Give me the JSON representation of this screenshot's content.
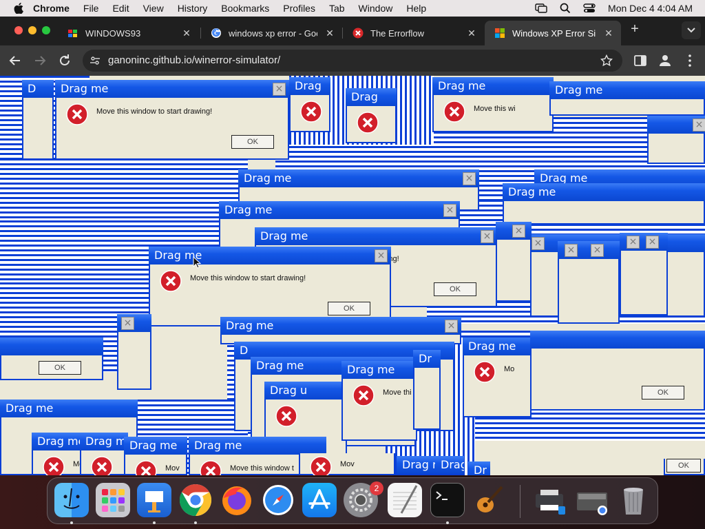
{
  "menubar": {
    "app_name": "Chrome",
    "items": [
      "File",
      "Edit",
      "View",
      "History",
      "Bookmarks",
      "Profiles",
      "Tab",
      "Window",
      "Help"
    ],
    "datetime": "Mon Dec 4  4:04 AM"
  },
  "tabs": [
    {
      "label": "WINDOWS93"
    },
    {
      "label": "windows xp error - Goo"
    },
    {
      "label": "The Errorflow"
    },
    {
      "label": "Windows XP Error Sim"
    }
  ],
  "address_bar": {
    "url": "ganoninc.github.io/winerror-simulator/"
  },
  "dialog": {
    "title": "Drag me",
    "title_short_1": "D",
    "title_short_2": "Drag m",
    "title_short_3": "Drag I",
    "title_short_4": "Dr",
    "title_short_5": "Drag r",
    "title_short_6": "Drag",
    "title_short_7": "Drag u",
    "title_short_8": "Drag me",
    "message": "Move this window to start drawing!",
    "message_partial_1": "Move this wi",
    "message_partial_2": "Move thi",
    "message_partial_3": "Mo",
    "message_partial_4": "Move this window t",
    "message_partial_5": "Mov",
    "message_partial_6": "ing!",
    "ok_label": "OK",
    "close_glyph": "×"
  },
  "dock": {
    "settings_badge": "2"
  },
  "colors": {
    "xp_blue": "#0a3fd6",
    "xp_face": "#ece9d8",
    "chrome_dark": "#1f1f1f",
    "chrome_toolbar": "#3a3a3a"
  }
}
